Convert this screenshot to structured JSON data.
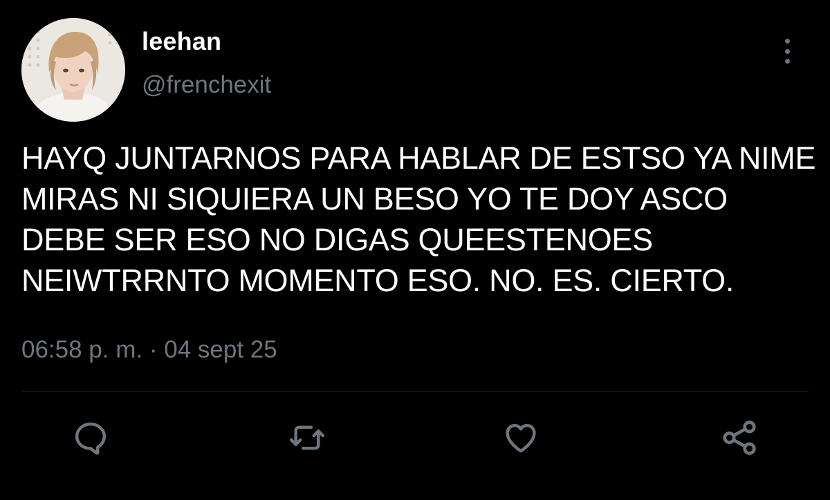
{
  "tweet": {
    "author": {
      "display_name": "leehan",
      "handle": "@frenchexit",
      "avatar_icon": "profile-photo"
    },
    "text": "HAYQ JUNTARNOS PARA HABLAR DE ESTSO YA NIME MIRAS NI SIQUIERA UN BESO YO TE DOY ASCO DEBE SER ESO NO DIGAS QUEESTENOES NEIWTRRNTO MOMENTO ESO. NO. ES. CIERTO.",
    "time": "06:58 p. m.",
    "separator": "·",
    "date": "04 sept 25"
  },
  "actions": {
    "icons": [
      "reply-icon",
      "retweet-icon",
      "like-icon",
      "share-icon"
    ],
    "more_icon": "more-vertical-icon"
  },
  "colors": {
    "background": "#000000",
    "text": "#ffffff",
    "secondary": "#6e767d",
    "divider": "#2f3336"
  }
}
